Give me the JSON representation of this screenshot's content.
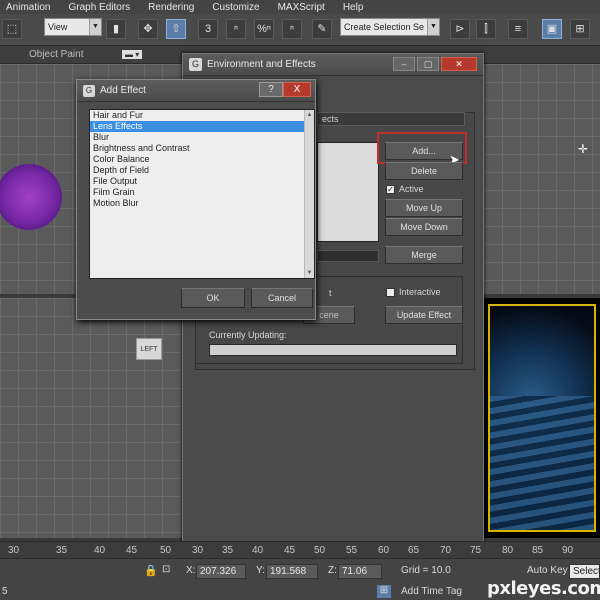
{
  "menu": [
    "Animation",
    "Graph Editors",
    "Rendering",
    "Customize",
    "MAXScript",
    "Help"
  ],
  "toolbar": {
    "view_select": "View",
    "selection_set_select": "Create Selection Se",
    "snap_labels": [
      "3",
      "ⁿ",
      "%ⁿ",
      "ⁿ"
    ]
  },
  "viewport": {
    "label": "Object Paint",
    "left_label": "LEFT"
  },
  "env_window": {
    "title": "Environment and Effects",
    "rollout_title": "ects",
    "add_button": "Add...",
    "delete_button": "Delete",
    "active_label": "Active",
    "active_checked": "✓",
    "move_up_button": "Move Up",
    "move_down_button": "Move Down",
    "merge_button": "Merge",
    "preview_partial": "t",
    "scene_partial": "cene",
    "interactive_label": "Interactive",
    "update_effect_button": "Update Effect",
    "currently_updating_label": "Currently Updating:"
  },
  "add_effect_dialog": {
    "title": "Add Effect",
    "help_btn": "?",
    "close_btn": "X",
    "items": [
      "Hair and Fur",
      "Lens Effects",
      "Blur",
      "Brightness and Contrast",
      "Color Balance",
      "Depth of Field",
      "File Output",
      "Film Grain",
      "Motion Blur"
    ],
    "selected_index": 1,
    "ok_button": "OK",
    "cancel_button": "Cancel"
  },
  "ruler": {
    "ticks": [
      "30",
      "35",
      "40",
      "45",
      "50",
      "30",
      "35",
      "40",
      "45",
      "50",
      "55",
      "60",
      "65",
      "70",
      "75",
      "80",
      "85",
      "90"
    ]
  },
  "status": {
    "x_label": "X:",
    "x_value": "207.326",
    "y_label": "Y:",
    "y_value": "191.568",
    "z_label": "Z:",
    "z_value": "71.06",
    "grid": "Grid = 10.0",
    "auto_key": "Auto Key",
    "selected": "Selecte",
    "add_time_tag": "Add Time Tag",
    "left_number": "5"
  },
  "watermark": "pxleyes.com",
  "colors": {
    "selection_blue": "#3b8fe0",
    "highlight_red": "#c0302a",
    "viewport_border": "#d6b400"
  }
}
